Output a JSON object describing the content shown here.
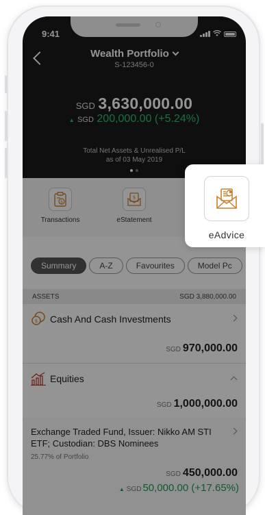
{
  "status_bar": {
    "time": "9:41"
  },
  "header": {
    "title": "Wealth Portfolio",
    "account": "S-123456-0",
    "currency": "SGD",
    "total_value": "3,630,000.00",
    "gain_currency": "SGD",
    "gain_value": "200,000.00 (+5.24%)",
    "note_line1": "Total Net Assets & Unrealised P/L",
    "note_line2": "as of 03 May 2019"
  },
  "quick_actions": [
    {
      "label": "Transactions",
      "icon": "transactions-icon"
    },
    {
      "label": "eStatement",
      "icon": "estatement-icon"
    }
  ],
  "popup": {
    "label": "eAdvice",
    "icon": "eadvice-icon",
    "accent": "#c9812b"
  },
  "tabs": [
    "Summary",
    "A-Z",
    "Favourites",
    "Model Pc"
  ],
  "assets": {
    "label": "ASSETS",
    "total": "SGD 3,880,000.00"
  },
  "rows": [
    {
      "title": "Cash And Cash Investments",
      "currency": "SGD",
      "amount": "970,000.00"
    },
    {
      "title": "Equities",
      "currency": "SGD",
      "amount": "1,000,000.00"
    }
  ],
  "etf": {
    "name": "Exchange Traded Fund, Issuer: Nikko AM STI ETF; Custodian: DBS Nominees",
    "percent": "25.77% of Portfolio",
    "currency": "SGD",
    "amount": "450,000.00",
    "gain_currency": "SGD",
    "gain": "50,000.00 (+17.65%)"
  },
  "colors": {
    "gain_green": "#27c46b",
    "header_bg": "#1b1b1b",
    "icon_gold": "#c9812b",
    "equities_red": "#c0392b"
  }
}
